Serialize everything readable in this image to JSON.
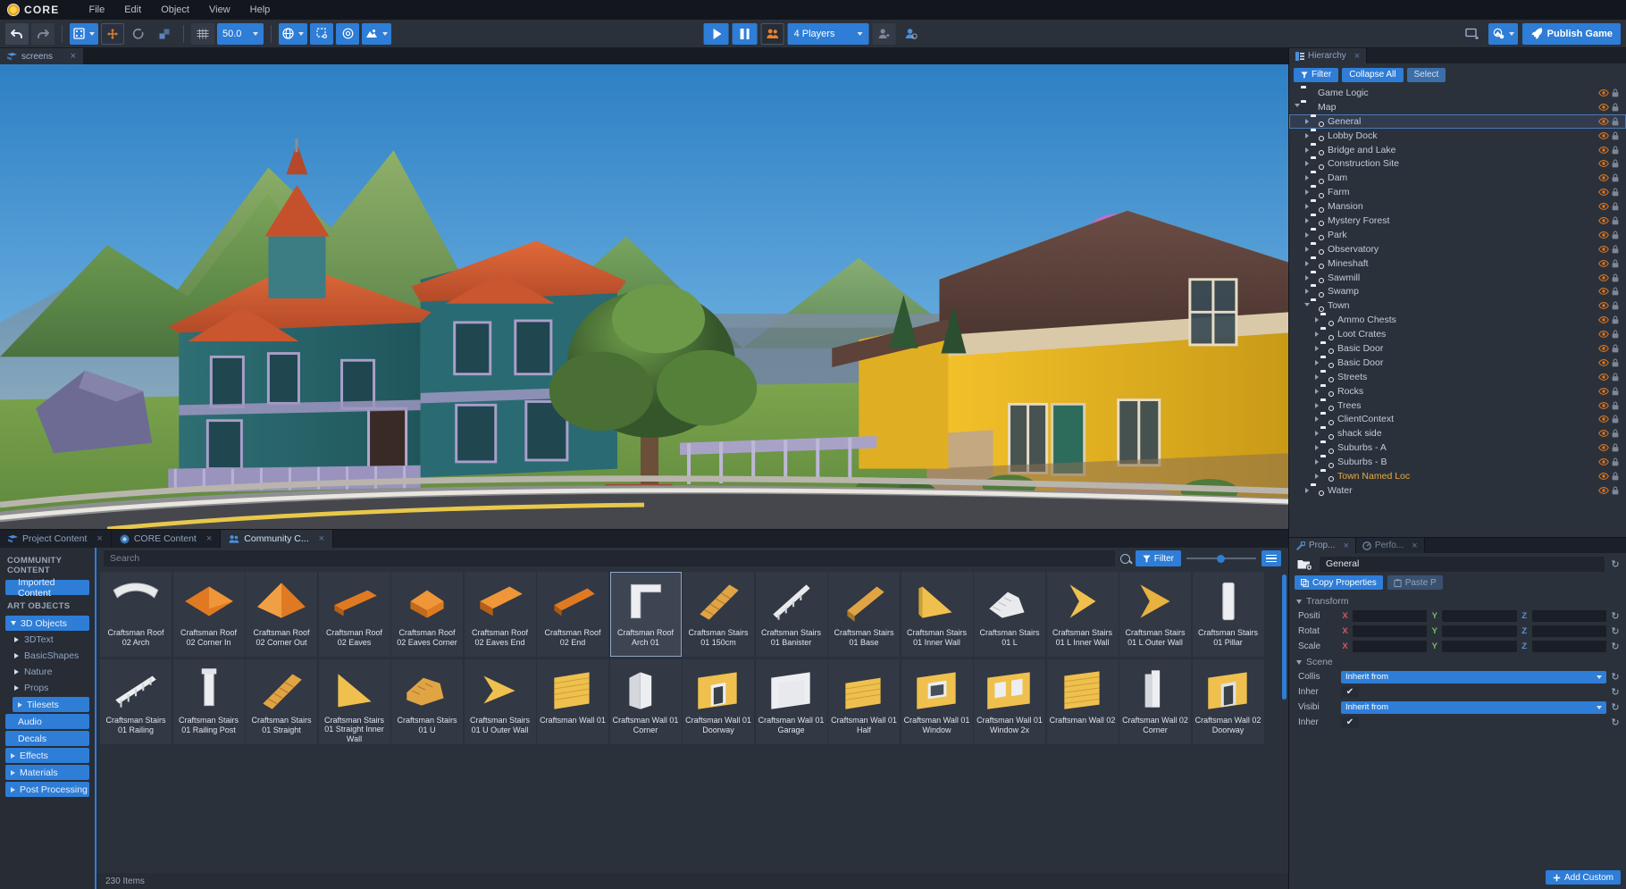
{
  "app": {
    "brand": "CORE",
    "menus": [
      "File",
      "Edit",
      "Object",
      "View",
      "Help"
    ]
  },
  "toolbar": {
    "undo_icon": "undo-arrow-icon",
    "redo_icon": "redo-arrow-icon",
    "grid_snap_icon": "grid-snap-icon",
    "move_icon": "move-tool-icon",
    "rotate_icon": "rotate-tool-icon",
    "scale_icon": "scale-tool-icon",
    "grid_icon": "grid-toggle-icon",
    "snap_value": "50.0",
    "world_icon": "world-space-icon",
    "pivot_icon": "pivot-icon",
    "target_icon": "target-icon",
    "camera_icon": "camera-preset-icon",
    "play_label": "play-button",
    "pause_label": "pause-button",
    "multiplayer_icon": "multiplayer-preview-icon",
    "players_value": "4 Players",
    "add_player_icon": "add-player-icon",
    "account_icon": "account-icon",
    "screenshot_icon": "screenshot-icon",
    "deploy_icon": "deploy-icon",
    "publish_label": "Publish Game"
  },
  "viewport": {
    "tab_label": "screens",
    "tab_icon": "viewport-tab-icon"
  },
  "assets": {
    "tabs": [
      {
        "label": "Project Content",
        "icon": "project-content-icon",
        "active": false
      },
      {
        "label": "CORE Content",
        "icon": "core-content-icon",
        "active": false
      },
      {
        "label": "Community C...",
        "icon": "community-content-icon",
        "active": true
      }
    ],
    "categories": [
      {
        "label": "COMMUNITY CONTENT",
        "type": "header"
      },
      {
        "label": "Imported Content",
        "type": "pill"
      },
      {
        "label": "ART OBJECTS",
        "type": "header"
      },
      {
        "label": "3D Objects",
        "type": "pill-open"
      },
      {
        "label": "3DText",
        "type": "sub"
      },
      {
        "label": "BasicShapes",
        "type": "sub"
      },
      {
        "label": "Nature",
        "type": "sub"
      },
      {
        "label": "Props",
        "type": "sub"
      },
      {
        "label": "Tilesets",
        "type": "pill-sub"
      },
      {
        "label": "Audio",
        "type": "pill"
      },
      {
        "label": "Decals",
        "type": "pill"
      },
      {
        "label": "Effects",
        "type": "pill"
      },
      {
        "label": "Materials",
        "type": "pill"
      },
      {
        "label": "Post Processing",
        "type": "pill"
      }
    ],
    "search_placeholder": "Search",
    "filter_label": "Filter",
    "zoom_value": 44,
    "list_view_icon": "list-view-icon",
    "status": "230 Items",
    "items": [
      {
        "label": "Craftsman Roof 02 Arch",
        "thumb": "arch-white",
        "selected": false
      },
      {
        "label": "Craftsman Roof 02 Corner In",
        "thumb": "roof-flat-orange",
        "selected": false
      },
      {
        "label": "Craftsman Roof 02 Corner Out",
        "thumb": "roof-pyramid-orange",
        "selected": false
      },
      {
        "label": "Craftsman Roof 02 Eaves",
        "thumb": "eaves-orange",
        "selected": false
      },
      {
        "label": "Craftsman Roof 02 Eaves Corner",
        "thumb": "eaves-corner-orange",
        "selected": false
      },
      {
        "label": "Craftsman Roof 02 Eaves End",
        "thumb": "eaves-end-orange",
        "selected": false
      },
      {
        "label": "Craftsman Roof 02 End",
        "thumb": "roof-end-orange",
        "selected": false
      },
      {
        "label": "Craftsman Roof Arch 01",
        "thumb": "arch-white2",
        "selected": true
      },
      {
        "label": "Craftsman Stairs 01 150cm",
        "thumb": "stairs-wood",
        "selected": false
      },
      {
        "label": "Craftsman Stairs 01 Banister",
        "thumb": "banister-white",
        "selected": false
      },
      {
        "label": "Craftsman Stairs 01 Base",
        "thumb": "stairs-base-wood",
        "selected": false
      },
      {
        "label": "Craftsman Stairs 01 Inner Wall",
        "thumb": "wedge-yellow",
        "selected": false
      },
      {
        "label": "Craftsman Stairs 01 L",
        "thumb": "stairs-l-wood",
        "selected": false
      },
      {
        "label": "Craftsman Stairs 01 L Inner Wall",
        "thumb": "chevron-yellow",
        "selected": false
      },
      {
        "label": "Craftsman Stairs 01 L Outer Wall",
        "thumb": "chevron-yellow2",
        "selected": false
      },
      {
        "label": "Craftsman Stairs 01 Pillar",
        "thumb": "pillar-white",
        "selected": false
      },
      {
        "label": "Craftsman Stairs 01 Railing",
        "thumb": "railing-white",
        "selected": false
      },
      {
        "label": "Craftsman Stairs 01 Railing Post",
        "thumb": "post-white",
        "selected": false
      },
      {
        "label": "Craftsman Stairs 01 Straight",
        "thumb": "stairs-straight-wood",
        "selected": false
      },
      {
        "label": "Craftsman Stairs 01 Straight Inner Wall",
        "thumb": "wedge-yellow2",
        "selected": false
      },
      {
        "label": "Craftsman Stairs 01 U",
        "thumb": "stairs-u-wood",
        "selected": false
      },
      {
        "label": "Craftsman Stairs 01 U Outer Wall",
        "thumb": "chevron-yellow3",
        "selected": false
      },
      {
        "label": "Craftsman Wall 01",
        "thumb": "wall-yellow",
        "selected": false
      },
      {
        "label": "Craftsman Wall 01 Corner",
        "thumb": "wall-corner-white",
        "selected": false
      },
      {
        "label": "Craftsman Wall 01 Doorway",
        "thumb": "wall-doorway-yellow",
        "selected": false
      },
      {
        "label": "Craftsman Wall 01 Garage",
        "thumb": "wall-garage-yellow",
        "selected": false
      },
      {
        "label": "Craftsman Wall 01 Half",
        "thumb": "wall-half-yellow",
        "selected": false
      },
      {
        "label": "Craftsman Wall 01 Window",
        "thumb": "wall-window-yellow",
        "selected": false
      },
      {
        "label": "Craftsman Wall 01 Window 2x",
        "thumb": "wall-window2x-yellow",
        "selected": false
      },
      {
        "label": "Craftsman Wall 02",
        "thumb": "wall2-yellow",
        "selected": false
      },
      {
        "label": "Craftsman Wall 02 Corner",
        "thumb": "wall2-corner-white",
        "selected": false
      },
      {
        "label": "Craftsman Wall 02 Doorway",
        "thumb": "wall2-doorway-yellow",
        "selected": false
      }
    ]
  },
  "hierarchy": {
    "tab_label": "Hierarchy",
    "tab_icon": "hierarchy-icon",
    "filter_label": "Filter",
    "collapse_label": "Collapse All",
    "select_label": "Select",
    "items": [
      {
        "label": "Game Logic",
        "depth": 0,
        "twisty": "none",
        "icon": "folder",
        "selected": false
      },
      {
        "label": "Map",
        "depth": 0,
        "twisty": "open",
        "icon": "folder",
        "selected": false
      },
      {
        "label": "General",
        "depth": 1,
        "twisty": "closed",
        "icon": "group",
        "selected": true
      },
      {
        "label": "Lobby Dock",
        "depth": 1,
        "twisty": "closed",
        "icon": "group",
        "selected": false
      },
      {
        "label": "Bridge and Lake",
        "depth": 1,
        "twisty": "closed",
        "icon": "group",
        "selected": false
      },
      {
        "label": "Construction Site",
        "depth": 1,
        "twisty": "closed",
        "icon": "group",
        "selected": false
      },
      {
        "label": "Dam",
        "depth": 1,
        "twisty": "closed",
        "icon": "group",
        "selected": false
      },
      {
        "label": "Farm",
        "depth": 1,
        "twisty": "closed",
        "icon": "group",
        "selected": false
      },
      {
        "label": "Mansion",
        "depth": 1,
        "twisty": "closed",
        "icon": "group",
        "selected": false
      },
      {
        "label": "Mystery Forest",
        "depth": 1,
        "twisty": "closed",
        "icon": "group",
        "selected": false
      },
      {
        "label": "Park",
        "depth": 1,
        "twisty": "closed",
        "icon": "group",
        "selected": false
      },
      {
        "label": "Observatory",
        "depth": 1,
        "twisty": "closed",
        "icon": "group",
        "selected": false
      },
      {
        "label": "Mineshaft",
        "depth": 1,
        "twisty": "closed",
        "icon": "group",
        "selected": false
      },
      {
        "label": "Sawmill",
        "depth": 1,
        "twisty": "closed",
        "icon": "group",
        "selected": false
      },
      {
        "label": "Swamp",
        "depth": 1,
        "twisty": "closed",
        "icon": "group",
        "selected": false
      },
      {
        "label": "Town",
        "depth": 1,
        "twisty": "open",
        "icon": "group",
        "selected": false
      },
      {
        "label": "Ammo Chests",
        "depth": 2,
        "twisty": "closed",
        "icon": "group",
        "selected": false
      },
      {
        "label": "Loot Crates",
        "depth": 2,
        "twisty": "closed",
        "icon": "group",
        "selected": false
      },
      {
        "label": "Basic Door",
        "depth": 2,
        "twisty": "closed",
        "icon": "group",
        "selected": false
      },
      {
        "label": "Basic Door",
        "depth": 2,
        "twisty": "closed",
        "icon": "group",
        "selected": false
      },
      {
        "label": "Streets",
        "depth": 2,
        "twisty": "closed",
        "icon": "group",
        "selected": false
      },
      {
        "label": "Rocks",
        "depth": 2,
        "twisty": "closed",
        "icon": "group",
        "selected": false
      },
      {
        "label": "Trees",
        "depth": 2,
        "twisty": "closed",
        "icon": "group",
        "selected": false
      },
      {
        "label": "ClientContext",
        "depth": 2,
        "twisty": "closed",
        "icon": "client",
        "selected": false
      },
      {
        "label": "shack side",
        "depth": 2,
        "twisty": "closed",
        "icon": "group",
        "selected": false
      },
      {
        "label": "Suburbs - A",
        "depth": 2,
        "twisty": "closed",
        "icon": "group",
        "selected": false
      },
      {
        "label": "Suburbs - B",
        "depth": 2,
        "twisty": "closed",
        "icon": "group",
        "selected": false
      },
      {
        "label": "Town Named Loc",
        "depth": 2,
        "twisty": "closed",
        "icon": "group",
        "selected": false,
        "highlight": true
      },
      {
        "label": "Water",
        "depth": 1,
        "twisty": "closed",
        "icon": "group",
        "selected": false
      }
    ]
  },
  "properties": {
    "tabs": [
      {
        "label": "Prop...",
        "icon": "properties-icon",
        "active": true
      },
      {
        "label": "Perfo...",
        "icon": "performance-icon",
        "active": false
      }
    ],
    "object_icon": "group-object-icon",
    "object_name": "General",
    "copy_label": "Copy Properties",
    "paste_label": "Paste P",
    "transform_section": "Transform",
    "scene_section": "Scene",
    "transform_rows": [
      {
        "label": "Positi",
        "axes": [
          "X",
          "Y",
          "Z"
        ]
      },
      {
        "label": "Rotat",
        "axes": [
          "X",
          "Y",
          "Z"
        ]
      },
      {
        "label": "Scale",
        "axes": [
          "X",
          "Y",
          "Z"
        ]
      }
    ],
    "scene_rows": [
      {
        "label": "Collis",
        "control": "dropdown",
        "value": "Inherit from"
      },
      {
        "label": "Inher",
        "control": "checkbox",
        "value": "✔"
      },
      {
        "label": "Visibi",
        "control": "dropdown",
        "value": "Inherit from"
      },
      {
        "label": "Inher",
        "control": "checkbox",
        "value": "✔"
      }
    ],
    "add_custom_label": "Add Custom"
  },
  "colors": {
    "accent_blue": "#2e7dd7",
    "panel_bg": "#2b313b",
    "dark_bg": "#1b1f27",
    "eye_orange": "#d9741f"
  }
}
